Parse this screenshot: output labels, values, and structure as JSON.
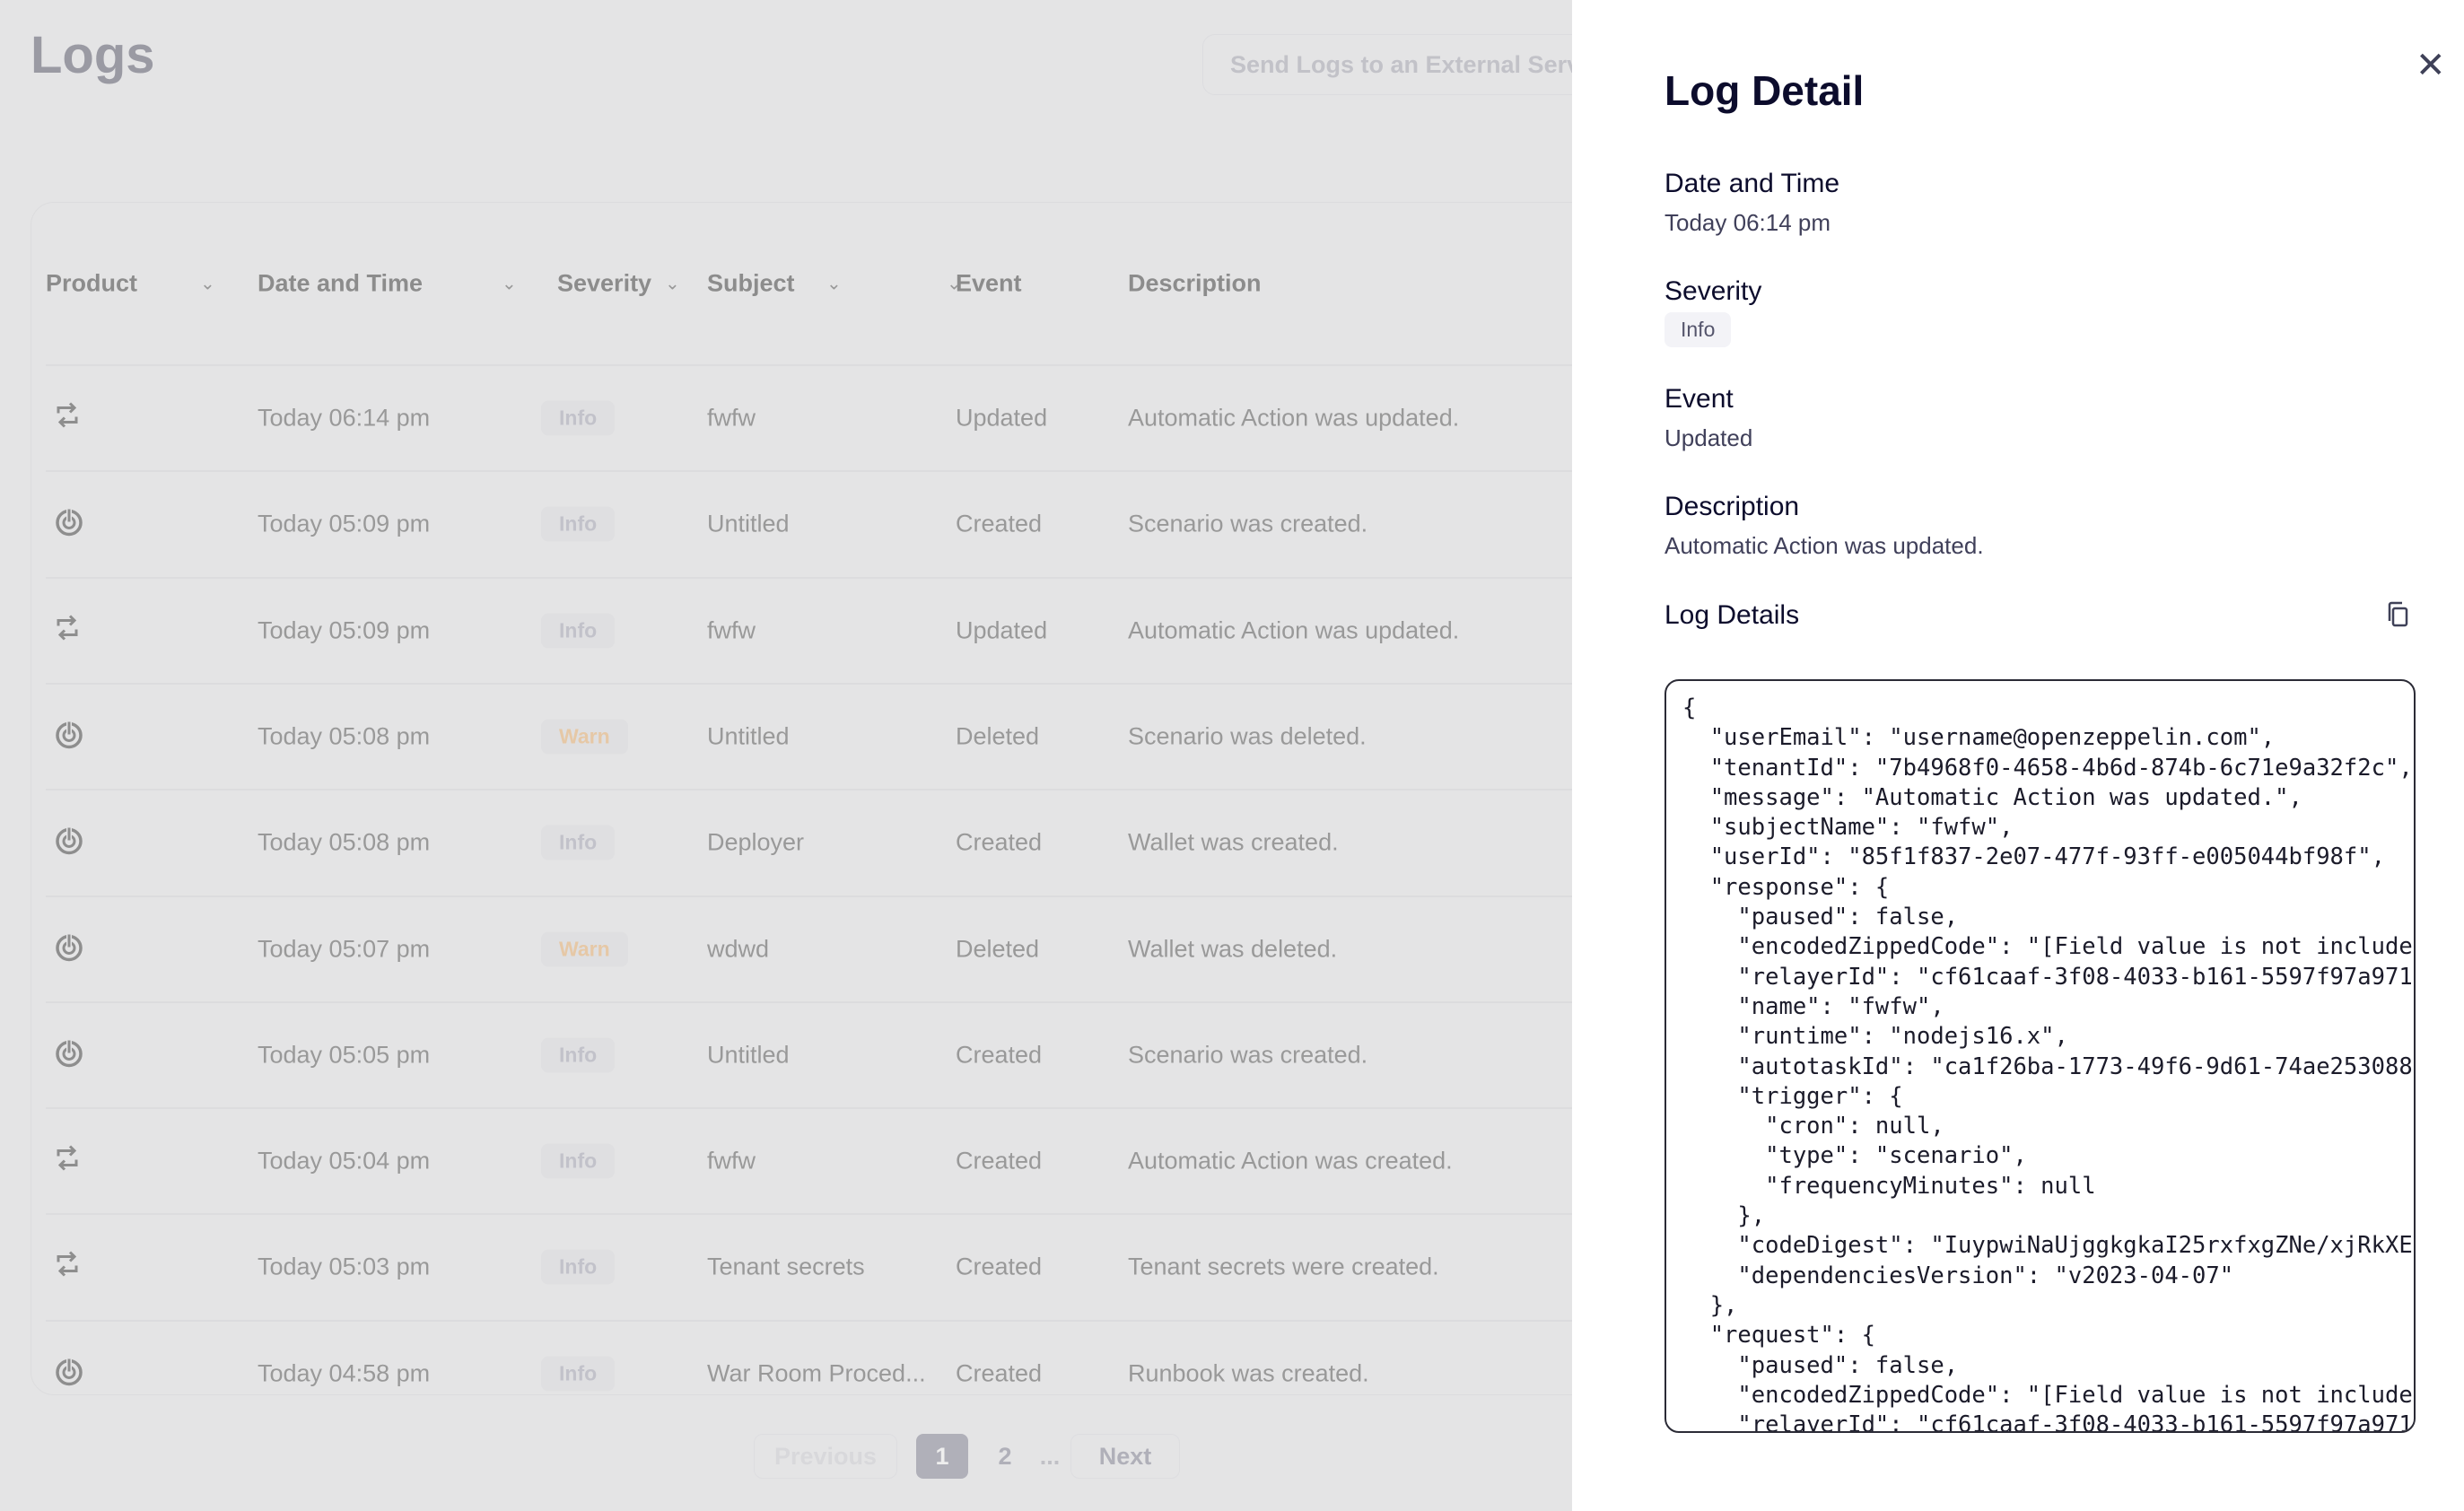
{
  "page": {
    "title": "Logs",
    "external_button": "Send Logs to an External Service"
  },
  "table": {
    "columns": [
      "Product",
      "Date and Time",
      "Severity",
      "Subject",
      "Event",
      "Description"
    ],
    "rows": [
      {
        "product": "repeat-icon",
        "date": "Today 06:14 pm",
        "severity": "Info",
        "subject": "fwfw",
        "event": "Updated",
        "description": "Automatic Action was updated."
      },
      {
        "product": "power-icon",
        "date": "Today 05:09 pm",
        "severity": "Info",
        "subject": "Untitled",
        "event": "Created",
        "description": "Scenario was created."
      },
      {
        "product": "repeat-icon",
        "date": "Today 05:09 pm",
        "severity": "Info",
        "subject": "fwfw",
        "event": "Updated",
        "description": "Automatic Action was updated."
      },
      {
        "product": "power-icon",
        "date": "Today 05:08 pm",
        "severity": "Warn",
        "subject": "Untitled",
        "event": "Deleted",
        "description": "Scenario was deleted."
      },
      {
        "product": "power-icon",
        "date": "Today 05:08 pm",
        "severity": "Info",
        "subject": "Deployer",
        "event": "Created",
        "description": "Wallet was created."
      },
      {
        "product": "power-icon",
        "date": "Today 05:07 pm",
        "severity": "Warn",
        "subject": "wdwd",
        "event": "Deleted",
        "description": "Wallet was deleted."
      },
      {
        "product": "power-icon",
        "date": "Today 05:05 pm",
        "severity": "Info",
        "subject": "Untitled",
        "event": "Created",
        "description": "Scenario was created."
      },
      {
        "product": "repeat-icon",
        "date": "Today 05:04 pm",
        "severity": "Info",
        "subject": "fwfw",
        "event": "Created",
        "description": "Automatic Action was created."
      },
      {
        "product": "repeat-icon",
        "date": "Today 05:03 pm",
        "severity": "Info",
        "subject": "Tenant secrets",
        "event": "Created",
        "description": "Tenant secrets were created."
      },
      {
        "product": "power-icon",
        "date": "Today 04:58 pm",
        "severity": "Info",
        "subject": "War Room Proced...",
        "event": "Created",
        "description": "Runbook was created."
      }
    ]
  },
  "pagination": {
    "previous": "Previous",
    "pages": [
      "1",
      "2"
    ],
    "current": "1",
    "ellipsis": "...",
    "next": "Next"
  },
  "detail": {
    "title": "Log Detail",
    "date_label": "Date and Time",
    "date": "Today 06:14 pm",
    "severity_label": "Severity",
    "severity": "Info",
    "event_label": "Event",
    "event": "Updated",
    "description_label": "Description",
    "description": "Automatic Action was updated.",
    "log_details_label": "Log Details",
    "json": "{\n  \"userEmail\": \"username@openzeppelin.com\",\n  \"tenantId\": \"7b4968f0-4658-4b6d-874b-6c71e9a32f2c\",\n  \"message\": \"Automatic Action was updated.\",\n  \"subjectName\": \"fwfw\",\n  \"userId\": \"85f1f837-2e07-477f-93ff-e005044bf98f\",\n  \"response\": {\n    \"paused\": false,\n    \"encodedZippedCode\": \"[Field value is not included]\",\n    \"relayerId\": \"cf61caaf-3f08-4033-b161-5597f97a971\n    \"name\": \"fwfw\",\n    \"runtime\": \"nodejs16.x\",\n    \"autotaskId\": \"ca1f26ba-1773-49f6-9d61-74ae253088\n    \"trigger\": {\n      \"cron\": null,\n      \"type\": \"scenario\",\n      \"frequencyMinutes\": null\n    },\n    \"codeDigest\": \"IuypwiNaUjggkgkaI25rxfxgZNe/xjRkXE\n    \"dependenciesVersion\": \"v2023-04-07\"\n  },\n  \"request\": {\n    \"paused\": false,\n    \"encodedZippedCode\": \"[Field value is not included]\",\n    \"relayerId\": \"cf61caaf-3f08-4033-b161-5597f97a971"
  },
  "colors": {
    "overlay": "#e4e4e5",
    "panel": "#ffffff",
    "title": "#0c0c2c",
    "warn": "#e6c8a6"
  }
}
